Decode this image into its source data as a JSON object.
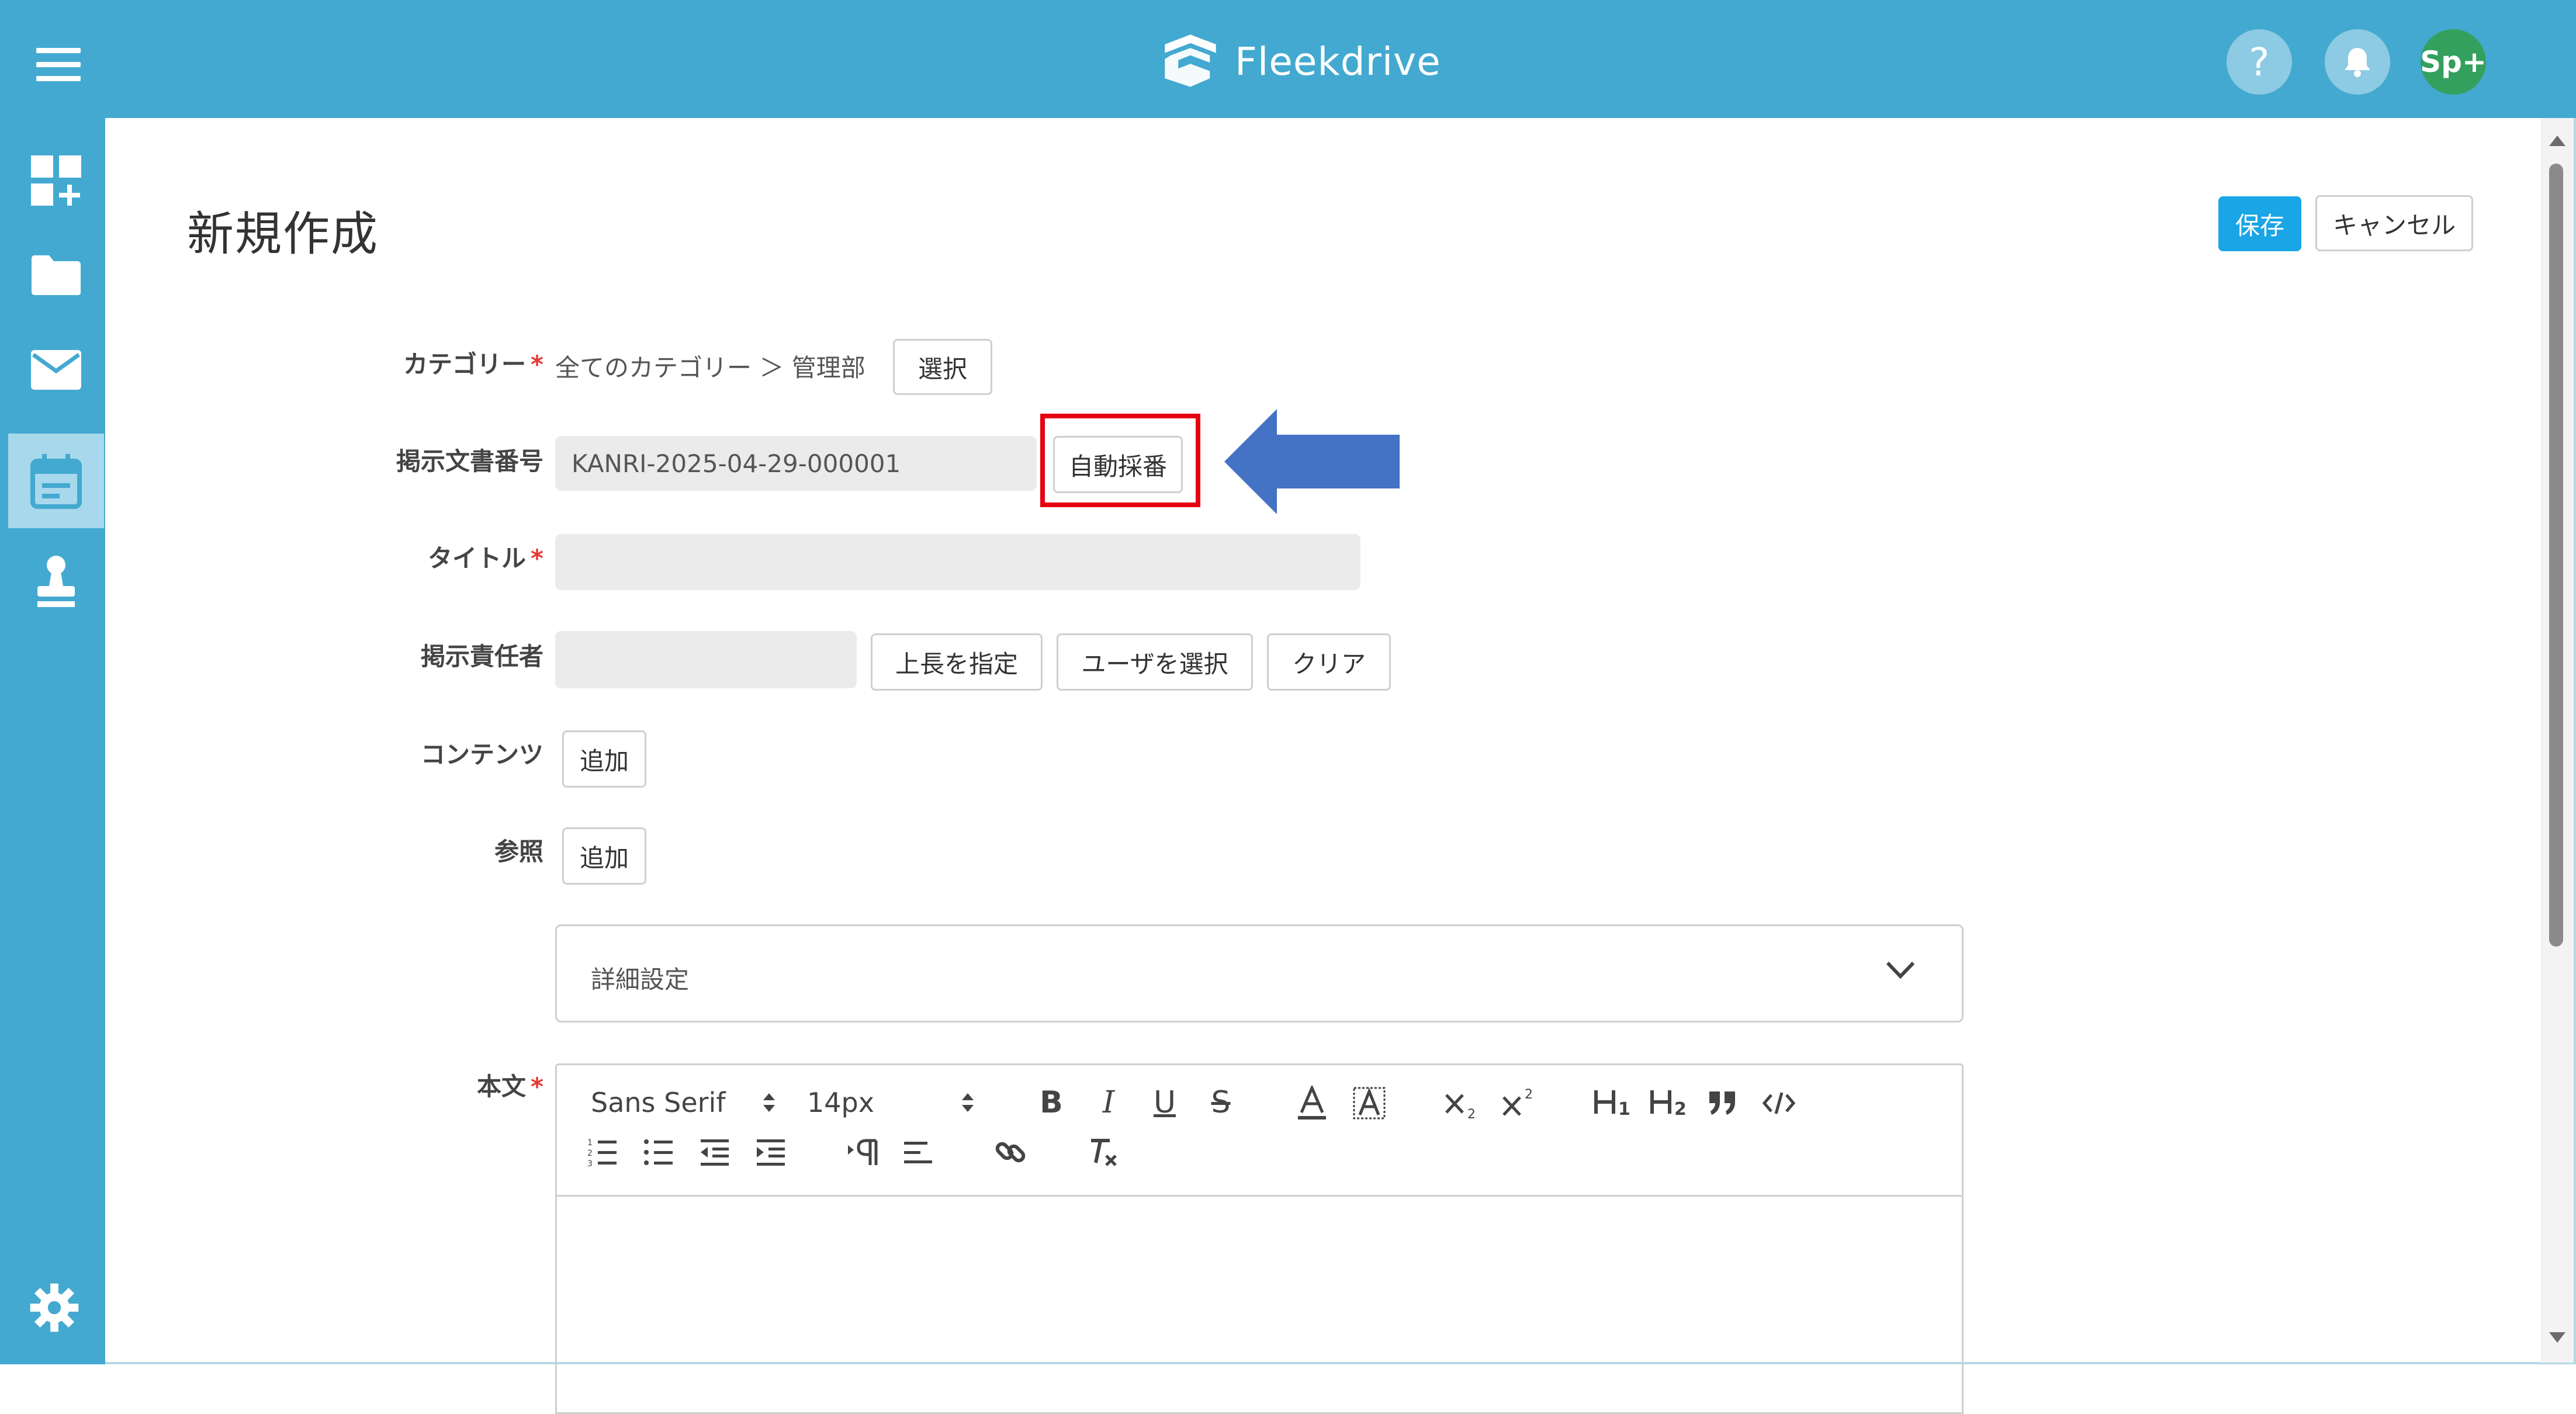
{
  "app": {
    "brand": "Fleekdrive",
    "avatar": "Sp+",
    "help_glyph": "?"
  },
  "colors": {
    "header": "#43a9d0",
    "primary": "#1aa5e6",
    "highlight": "#e60012",
    "arrow": "#4472c4",
    "avatar": "#34a05e"
  },
  "sidebar": {
    "items": [
      {
        "icon": "dashboard-add-icon"
      },
      {
        "icon": "folder-icon"
      },
      {
        "icon": "mail-icon"
      },
      {
        "icon": "calendar-icon",
        "active": true
      },
      {
        "icon": "stamp-icon"
      }
    ],
    "footer_icon": "gear-icon"
  },
  "page": {
    "title": "新規作成",
    "save_label": "保存",
    "cancel_label": "キャンセル"
  },
  "form": {
    "category": {
      "label": "カテゴリー",
      "value": "全てのカテゴリー ＞ 管理部",
      "select_label": "選択"
    },
    "doc_number": {
      "label": "掲示文書番号",
      "value": "KANRI-2025-04-29-000001",
      "auto_label": "自動採番"
    },
    "title": {
      "label": "タイトル",
      "value": ""
    },
    "owner": {
      "label": "掲示責任者",
      "value": "",
      "boss_label": "上長を指定",
      "user_label": "ユーザを選択",
      "clear_label": "クリア"
    },
    "contents": {
      "label": "コンテンツ",
      "add_label": "追加"
    },
    "reference": {
      "label": "参照",
      "add_label": "追加"
    },
    "details": {
      "label": "詳細設定"
    },
    "body": {
      "label": "本文"
    }
  },
  "editor": {
    "font_family": "Sans Serif",
    "font_size": "14px"
  }
}
